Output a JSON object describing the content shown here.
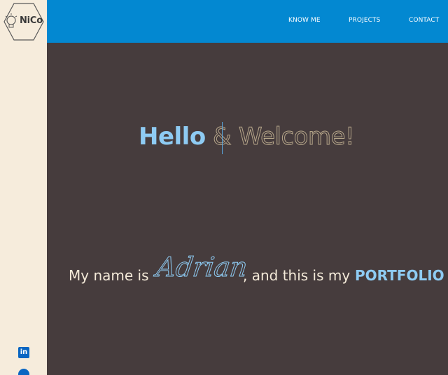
{
  "brand": {
    "logo_text": "NiCo",
    "logo_icon": "lightbulb-gear-icon"
  },
  "nav": {
    "items": [
      {
        "label": "KNOW ME"
      },
      {
        "label": "PROJECTS"
      },
      {
        "label": "CONTACT"
      }
    ]
  },
  "hero": {
    "greeting": "Hello",
    "ampersand": "&",
    "welcome": "Welcome!",
    "intro_prefix": "My name is",
    "name": "Adrian",
    "intro_suffix": ", and this is my",
    "highlight": "PORTFOLIO"
  },
  "social": {
    "linkedin_icon": "linkedin-icon",
    "linkedin_glyph": "in",
    "github_icon": "github-icon"
  },
  "colors": {
    "header": "#0388d1",
    "sidebar": "#f6ecdc",
    "background": "#463c3d",
    "accent": "#8ecbf3",
    "outline": "#b6a68a",
    "text": "#f3e9d8"
  }
}
